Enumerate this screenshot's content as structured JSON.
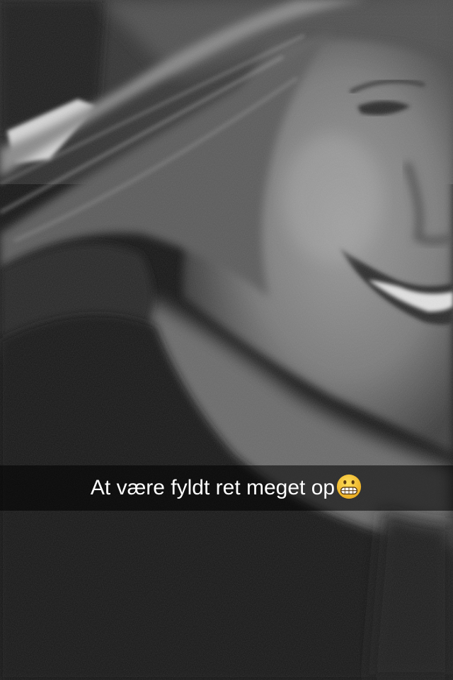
{
  "snap": {
    "caption": "At være fyldt ret meget op",
    "caption_emoji": "grimacing-face-emoji",
    "photo_subject": "selfie",
    "photo_tone": "black-and-white"
  },
  "colors": {
    "caption_bar": "#000000",
    "caption_text": "#ffffff",
    "emoji_face": "#f4c12a"
  }
}
